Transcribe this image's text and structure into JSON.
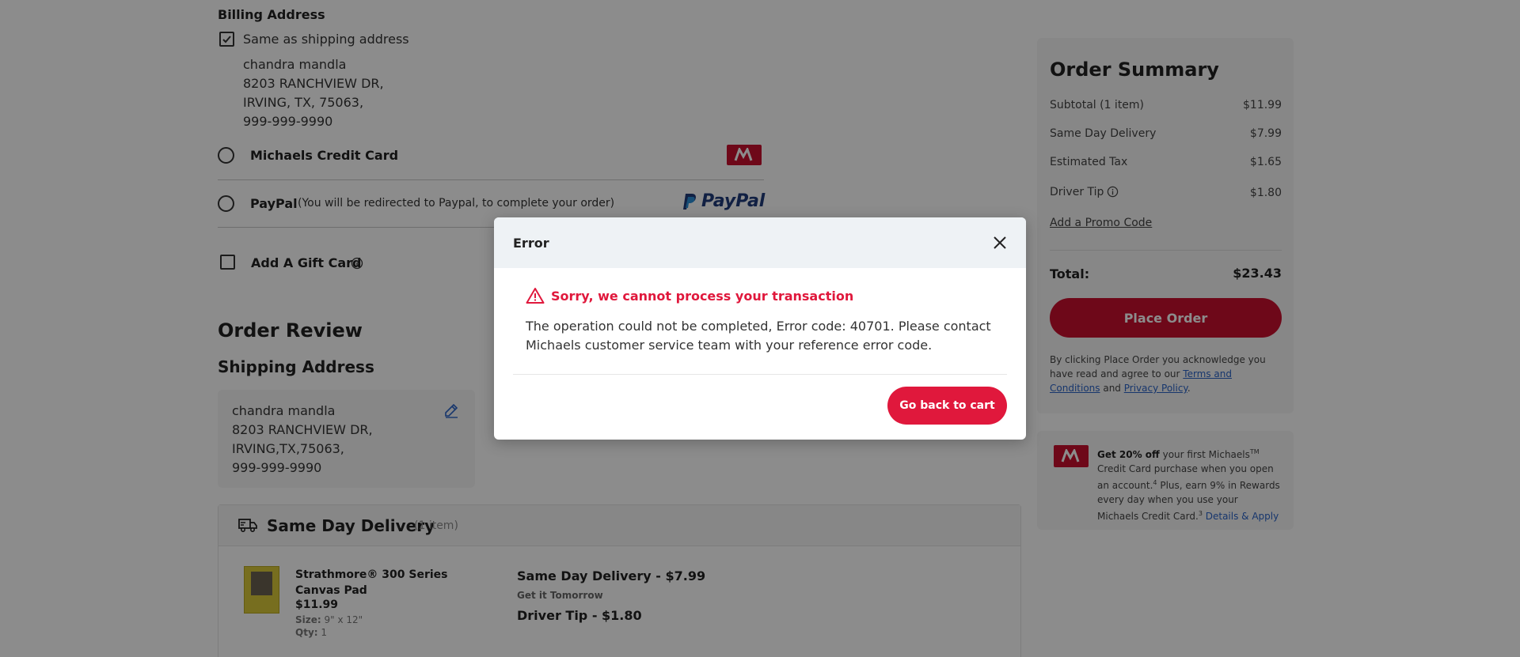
{
  "billing": {
    "title": "Billing Address",
    "same_as_shipping_label": "Same as shipping address",
    "same_as_shipping_checked": true,
    "name": "chandra mandla",
    "line1": "8203 RANCHVIEW DR,",
    "line2": "IRVING, TX, 75063,",
    "phone": "999-999-9990"
  },
  "payment": {
    "credit_card_label": "Michaels Credit Card",
    "paypal_label": "PayPal",
    "paypal_note": "(You will be redirected to Paypal, to complete your order)",
    "paypal_logo_text": "PayPal",
    "gift_card_label": "Add A Gift Card"
  },
  "order_review": {
    "title": "Order Review",
    "shipping_title": "Shipping Address",
    "name": "chandra mandla",
    "line1": "8203 RANCHVIEW DR,",
    "line2": "IRVING,TX,75063,",
    "phone": "999-999-9990"
  },
  "delivery": {
    "title": "Same Day Delivery",
    "count": "(1 item)",
    "product_name": "Strathmore® 300 Series Canvas Pad",
    "price": "$11.99",
    "size_label": "Size:",
    "size_value": "9\" x 12\"",
    "qty_label": "Qty:",
    "qty_value": "1",
    "method": "Same Day Delivery - $7.99",
    "eta": "Get it Tomorrow",
    "tip": "Driver Tip - $1.80"
  },
  "summary": {
    "title": "Order Summary",
    "rows": [
      {
        "label": "Subtotal (1 item)",
        "value": "$11.99"
      },
      {
        "label": "Same Day Delivery",
        "value": "$7.99"
      },
      {
        "label": "Estimated Tax",
        "value": "$1.65"
      },
      {
        "label": "Driver Tip",
        "value": "$1.80"
      }
    ],
    "promo_link": "Add a Promo Code",
    "total_label": "Total:",
    "total_value": "$23.43",
    "place_order": "Place Order",
    "legal_1": "By clicking Place Order you acknowledge you have read and agree to our",
    "terms_link": "Terms and Conditions",
    "legal_and": "and",
    "privacy_link": "Privacy Policy",
    "legal_end": "."
  },
  "promo_card": {
    "bold": "Get 20% off",
    "text1": "your first Michaels",
    "tm": "TM",
    "text2": "Credit Card purchase when you open an account.",
    "sup4": "4",
    "text3": "Plus, earn 9% in Rewards every day when you use your Michaels Credit Card.",
    "sup3": "3",
    "link": "Details & Apply"
  },
  "modal": {
    "title": "Error",
    "error_title": "Sorry, we cannot process your transaction",
    "error_body": "The operation could not be completed, Error code: 40701. Please contact Michaels customer service team with your reference error code.",
    "button": "Go back to cart"
  },
  "colors": {
    "brand_red": "#c8102e",
    "error_red": "#e0183c",
    "link_blue": "#2a63c6"
  }
}
